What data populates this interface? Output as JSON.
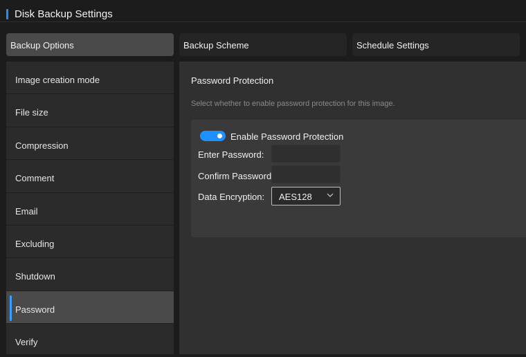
{
  "window": {
    "title": "Disk Backup Settings"
  },
  "tabs": [
    {
      "label": "Backup Options"
    },
    {
      "label": "Backup Scheme"
    },
    {
      "label": "Schedule Settings"
    }
  ],
  "sidebar": {
    "items": [
      {
        "label": "Image creation mode"
      },
      {
        "label": "File size"
      },
      {
        "label": "Compression"
      },
      {
        "label": "Comment"
      },
      {
        "label": "Email"
      },
      {
        "label": "Excluding"
      },
      {
        "label": "Shutdown"
      },
      {
        "label": "Password"
      },
      {
        "label": "Verify"
      }
    ],
    "active_index": 7
  },
  "password_panel": {
    "title": "Password Protection",
    "description": "Select whether to enable password protection for this image.",
    "toggle_label": "Enable Password Protection",
    "toggle_on": true,
    "enter_label": "Enter Password:",
    "enter_value": "",
    "confirm_label": "Confirm Password:",
    "confirm_value": "",
    "encryption_label": "Data Encryption:",
    "encryption_value": "AES128"
  },
  "colors": {
    "accent": "#1e90ff",
    "background": "#1c1c1c",
    "panel": "#303030",
    "selected": "#4a4a4a"
  }
}
